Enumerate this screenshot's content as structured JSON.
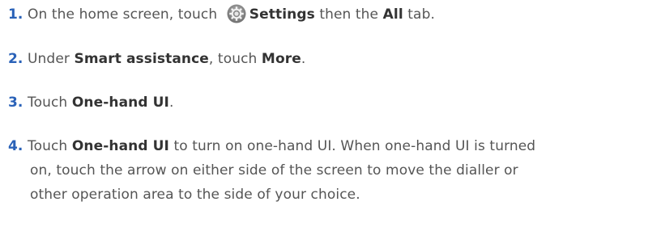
{
  "steps": [
    {
      "number": "1.",
      "t1": "On the home screen, touch",
      "b1": "Settings",
      "t2": "then the",
      "b2": "All",
      "t3": "tab."
    },
    {
      "number": "2.",
      "t1": "Under",
      "b1": "Smart assistance",
      "t2": ", touch",
      "b2": "More",
      "t3": "."
    },
    {
      "number": "3.",
      "t1": "Touch",
      "b1": "One-hand UI",
      "t2": "."
    },
    {
      "number": "4.",
      "t1": "Touch",
      "b1": "One-hand UI",
      "line1": "to turn on one-hand UI. When one-hand UI is turned",
      "line2": "on, touch the arrow on either side of the screen to move the dialler or",
      "line3": "other operation area to the side of your choice."
    }
  ],
  "icons": {
    "settings": "settings-gear-icon"
  },
  "colors": {
    "step_number": "#2a62b8",
    "text": "#555555",
    "bold": "#333333"
  }
}
